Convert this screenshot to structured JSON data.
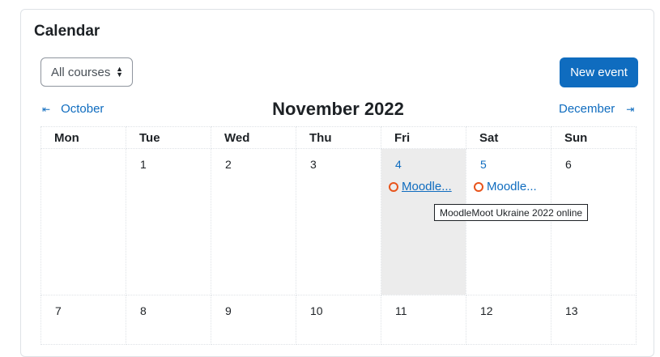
{
  "card": {
    "title": "Calendar"
  },
  "toolbar": {
    "course_filter": "All courses",
    "new_event_label": "New event"
  },
  "navigation": {
    "prev_month": "October",
    "current_month": "November 2022",
    "next_month": "December"
  },
  "weekdays": [
    "Mon",
    "Tue",
    "Wed",
    "Thu",
    "Fri",
    "Sat",
    "Sun"
  ],
  "weeks": [
    [
      "",
      "1",
      "2",
      "3",
      "4",
      "5",
      "6"
    ],
    [
      "7",
      "8",
      "9",
      "10",
      "11",
      "12",
      "13"
    ]
  ],
  "events": {
    "fri": "Moodle...",
    "sat": "Moodle..."
  },
  "tooltip": "MoodleMoot Ukraine 2022 online",
  "colors": {
    "primary": "#0f6cbf",
    "today_bg": "#ececec",
    "event_dot": "#e8541b"
  }
}
